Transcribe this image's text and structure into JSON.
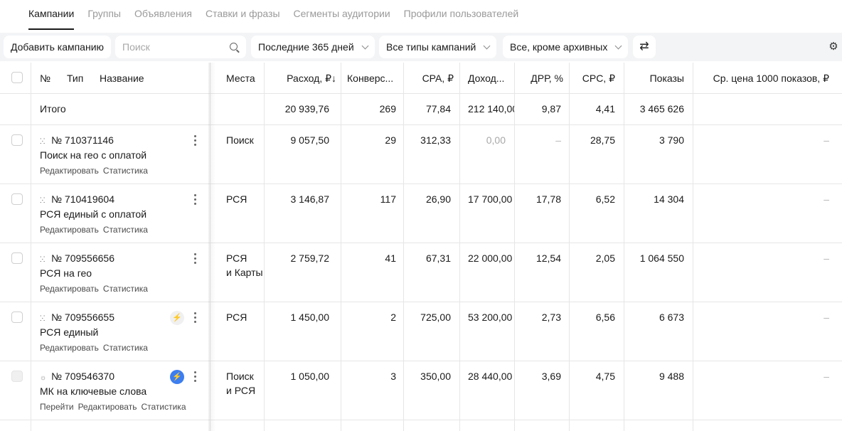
{
  "tabs": [
    "Кампании",
    "Группы",
    "Объявления",
    "Ставки и фразы",
    "Сегменты аудитории",
    "Профили пользователей"
  ],
  "toolbar": {
    "add_label": "Добавить кампанию",
    "search_placeholder": "Поиск",
    "period_label": "Последние 365 дней",
    "types_label": "Все типы кампаний",
    "archive_label": "Все, кроме архивных"
  },
  "header": {
    "no": "№",
    "type": "Тип",
    "name": "Название",
    "places": "Места",
    "spend": "Расход, ₽↓",
    "conv": "Конверс...",
    "cpa": "CPA, ₽",
    "income": "Доход...",
    "drr": "ДРР, %",
    "cpc": "CPC, ₽",
    "shows": "Показы",
    "cpm": "Ср. цена 1000 показов, ₽"
  },
  "total": {
    "label": "Итого",
    "spend": "20 939,76",
    "conv": "269",
    "cpa": "77,84",
    "income": "212 140,00",
    "drr": "9,87",
    "cpc": "4,41",
    "shows": "3 465 626"
  },
  "rows": [
    {
      "id": "№ 710371146",
      "name": "Поиск на гео с оплатой",
      "links": [
        "Редактировать",
        "Статистика"
      ],
      "places": [
        "Поиск"
      ],
      "spend": "9 057,50",
      "conv": "29",
      "cpa": "312,33",
      "income": "0,00",
      "drr": "–",
      "cpc": "28,75",
      "shows": "3 790",
      "cpm": "–"
    },
    {
      "id": "№ 710419604",
      "name": "РСЯ единый с оплатой",
      "links": [
        "Редактировать",
        "Статистика"
      ],
      "places": [
        "РСЯ"
      ],
      "spend": "3 146,87",
      "conv": "117",
      "cpa": "26,90",
      "income": "17 700,00",
      "drr": "17,78",
      "cpc": "6,52",
      "shows": "14 304",
      "cpm": "–"
    },
    {
      "id": "№ 709556656",
      "name": "РСЯ на гео",
      "links": [
        "Редактировать",
        "Статистика"
      ],
      "places": [
        "РСЯ",
        "и Карты"
      ],
      "spend": "2 759,72",
      "conv": "41",
      "cpa": "67,31",
      "income": "22 000,00",
      "drr": "12,54",
      "cpc": "2,05",
      "shows": "1 064 550",
      "cpm": "–"
    },
    {
      "id": "№ 709556655",
      "name": "РСЯ единый",
      "links": [
        "Редактировать",
        "Статистика"
      ],
      "places": [
        "РСЯ"
      ],
      "spend": "1 450,00",
      "conv": "2",
      "cpa": "725,00",
      "income": "53 200,00",
      "drr": "2,73",
      "cpc": "6,56",
      "shows": "6 673",
      "cpm": "–"
    },
    {
      "id": "№ 709546370",
      "name": "МК на ключевые слова",
      "links": [
        "Перейти",
        "Редактировать",
        "Статистика"
      ],
      "places": [
        "Поиск",
        "и РСЯ"
      ],
      "spend": "1 050,00",
      "conv": "3",
      "cpa": "350,00",
      "income": "28 440,00",
      "drr": "3,69",
      "cpc": "4,75",
      "shows": "9 488",
      "cpm": "–"
    }
  ]
}
